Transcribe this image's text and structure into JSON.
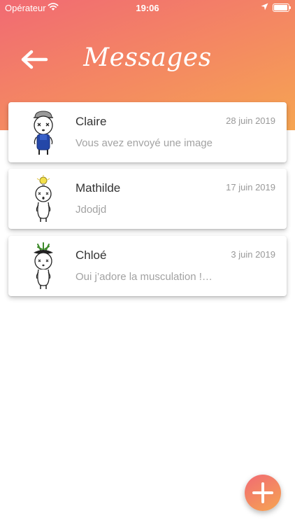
{
  "status_bar": {
    "carrier": "Opérateur",
    "time": "19:06",
    "battery_level": 0.95
  },
  "header": {
    "title": "Messages",
    "back_icon": "back-arrow-icon"
  },
  "conversations": [
    {
      "name": "Claire",
      "date": "28 juin 2019",
      "preview": "Vous avez envoyé une image",
      "avatar": "cap-character-avatar"
    },
    {
      "name": "Mathilde",
      "date": "17 juin 2019",
      "preview": "Jdodjd",
      "avatar": "lightbulb-character-avatar"
    },
    {
      "name": "Chloé",
      "date": "3 juin 2019",
      "preview": "Oui j’adore la musculation !…",
      "avatar": "plant-character-avatar"
    }
  ],
  "fab": {
    "icon": "plus-icon"
  },
  "colors": {
    "gradient_start": "#f16a73",
    "gradient_end": "#f6a552",
    "name_text": "#333333",
    "secondary_text": "#a2a2a2"
  }
}
